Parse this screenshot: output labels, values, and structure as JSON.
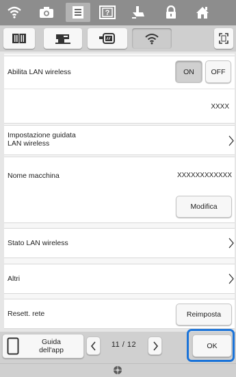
{
  "top_icons": [
    {
      "name": "wireless-icon",
      "selected": false
    },
    {
      "name": "camera-icon",
      "selected": false
    },
    {
      "name": "settings-page-icon",
      "selected": true
    },
    {
      "name": "help-question-icon",
      "selected": false
    },
    {
      "name": "presser-foot-icon",
      "selected": false
    },
    {
      "name": "lock-icon",
      "selected": false
    },
    {
      "name": "home-icon",
      "selected": false
    }
  ],
  "sub_tabs": [
    {
      "name": "book-tab-icon",
      "selected": false
    },
    {
      "name": "sewing-machine-tab-icon",
      "selected": false
    },
    {
      "name": "embroidery-frame-tab-icon",
      "selected": false
    },
    {
      "name": "wifi-tab-icon",
      "selected": true
    }
  ],
  "sections": {
    "wireless_lan": {
      "label": "Abilita LAN wireless",
      "on_label": "ON",
      "off_label": "OFF",
      "state": "ON",
      "network_value": "XXXX"
    },
    "setup_wizard": {
      "label_line1": "Impostazione guidata",
      "label_line2": "LAN wireless"
    },
    "machine_name": {
      "label": "Nome macchina",
      "value": "XXXXXXXXXXXX",
      "button_label": "Modifica"
    },
    "wireless_status": {
      "label": "Stato LAN wireless"
    },
    "others": {
      "label": "Altri"
    },
    "network_reset": {
      "label": "Resett. rete",
      "button_label": "Reimposta"
    }
  },
  "footer": {
    "guide_label_line1": "Guida",
    "guide_label_line2": "dell'app",
    "page_indicator": "11 / 12",
    "ok_label": "OK"
  },
  "colors": {
    "highlight": "#1a73d9",
    "top_bar": "#8d8d8d",
    "panel": "#ffffff",
    "background": "#e6e6e6"
  }
}
